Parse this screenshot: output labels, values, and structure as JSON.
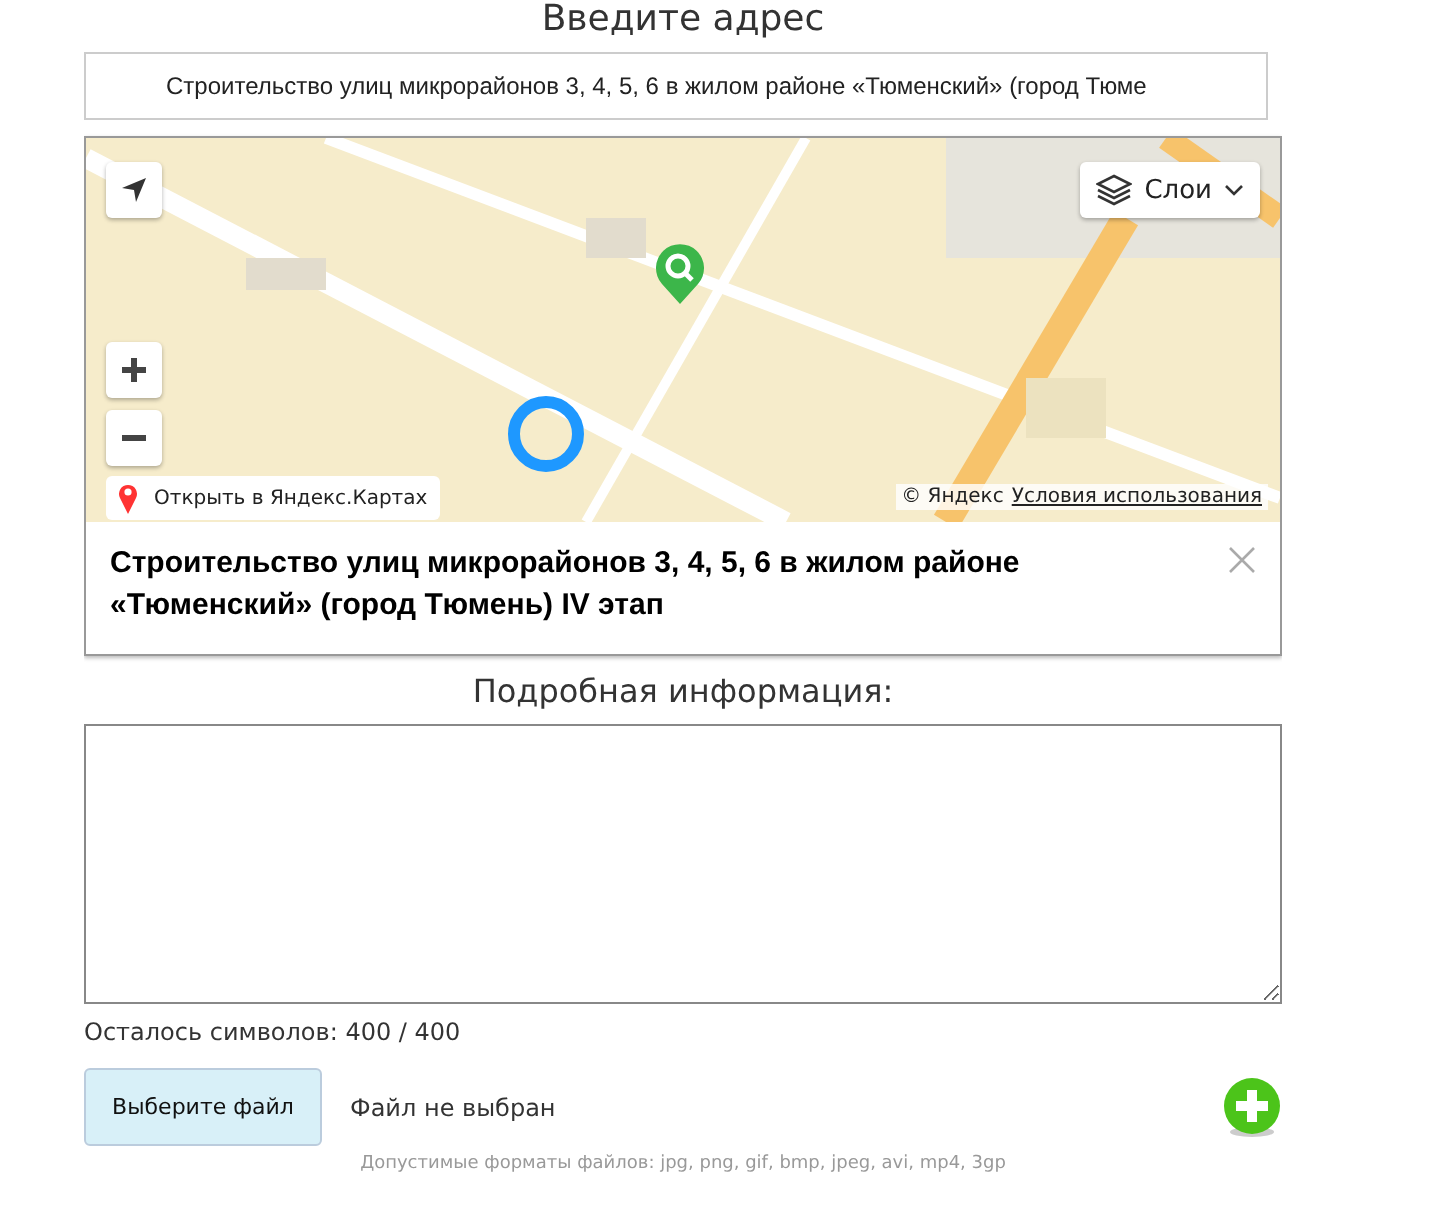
{
  "heading": "Введите адрес",
  "address": {
    "value": "Строительство улиц микрорайонов 3, 4, 5, 6 в жилом районе «Тюменский» (город Тюме"
  },
  "map": {
    "layers_button": "Слои",
    "open_link": "Открыть в Яндекс.Картах",
    "copyright": "© Яндекс",
    "terms_link": "Условия использования",
    "balloon": {
      "title": "Строительство улиц микрорайонов 3, 4, 5, 6 в жилом районе «Тюменский» (город Тюмень) IV этап"
    }
  },
  "details": {
    "label": "Подробная информация:",
    "counter": "Осталось символов: 400 / 400"
  },
  "file": {
    "button": "Выберите файл",
    "status": "Файл не выбран"
  },
  "formats_note": "Допустимые форматы файлов: jpg, png, gif, bmp, jpeg, avi, mp4, 3gp"
}
